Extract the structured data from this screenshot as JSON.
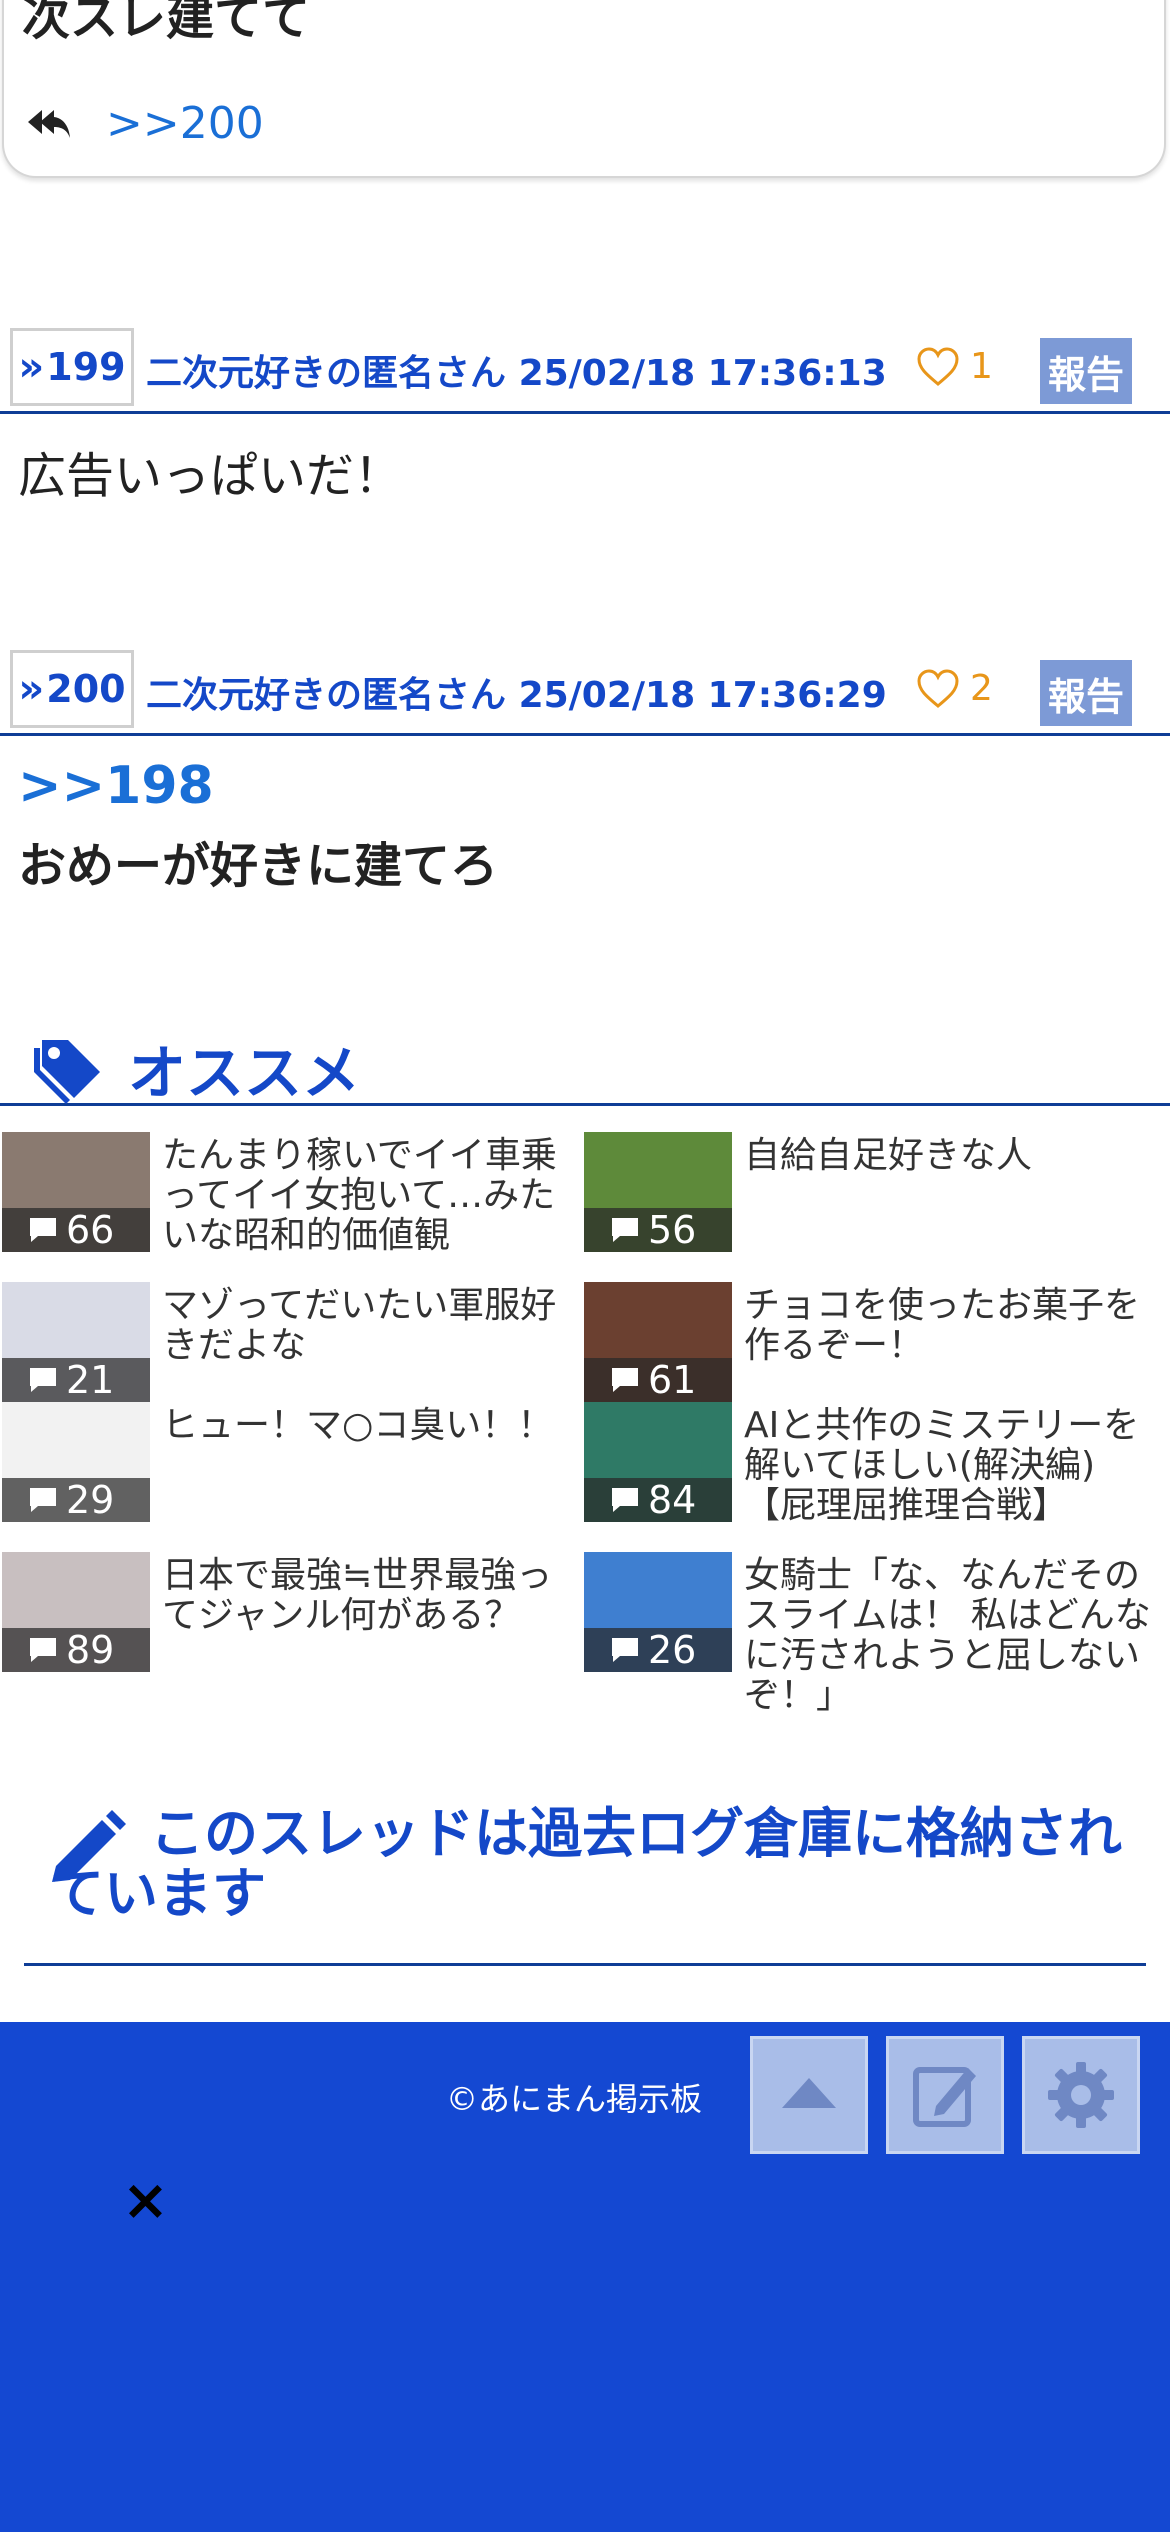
{
  "top_post": {
    "cut_text": "次スレ建てて",
    "reply_label": ">>200"
  },
  "posts": [
    {
      "num": "199",
      "author": "二次元好きの匿名さん",
      "datetime": "25/02/18 17:36:13",
      "likes": "1",
      "report": "報告",
      "body": "広告いっぱいだ！"
    },
    {
      "num": "200",
      "author": "二次元好きの匿名さん",
      "datetime": "25/02/18 17:36:29",
      "likes": "2",
      "report": "報告",
      "anchor": ">>198",
      "body": "おめーが好きに建てろ"
    }
  ],
  "recommend": {
    "title": "オススメ",
    "items": [
      {
        "count": "66",
        "title": "たんまり稼いでイイ車乗ってイイ女抱いて…みたいな昭和的価値観",
        "thumb_color": "#8a7a70"
      },
      {
        "count": "56",
        "title": "自給自足好きな人",
        "thumb_color": "#5e8a3a"
      },
      {
        "count": "21",
        "title": "マゾってだいたい軍服好きだよな",
        "thumb_color": "#d9dbe6"
      },
      {
        "count": "61",
        "title": "チョコを使ったお菓子を作るぞー！",
        "thumb_color": "#6b4030"
      },
      {
        "count": "29",
        "title": "ヒュー！マ○コ臭い！！",
        "thumb_color": "#f2f2f2"
      },
      {
        "count": "84",
        "title": "AIと共作のミステリーを解いてほしい(解決編)【屁理屈推理合戦】",
        "thumb_color": "#2f7a66"
      },
      {
        "count": "89",
        "title": "日本で最強≒世界最強ってジャンル何がある？",
        "thumb_color": "#c8bfc0"
      },
      {
        "count": "26",
        "title": "女騎士「な、なんだそのスライムは！ 私はどんなに汚されようと屈しないぞ！」",
        "thumb_color": "#3f7fd0"
      }
    ]
  },
  "archive_note": "このスレッドは過去ログ倉庫に格納されています",
  "footer": {
    "copyright": "©あにまん掲示板",
    "close": "×"
  },
  "colors": {
    "brand_blue": "#1448d2",
    "link_blue": "#1a6fd6",
    "like_orange": "#e8961a",
    "report_bg": "#7d9ad6"
  }
}
